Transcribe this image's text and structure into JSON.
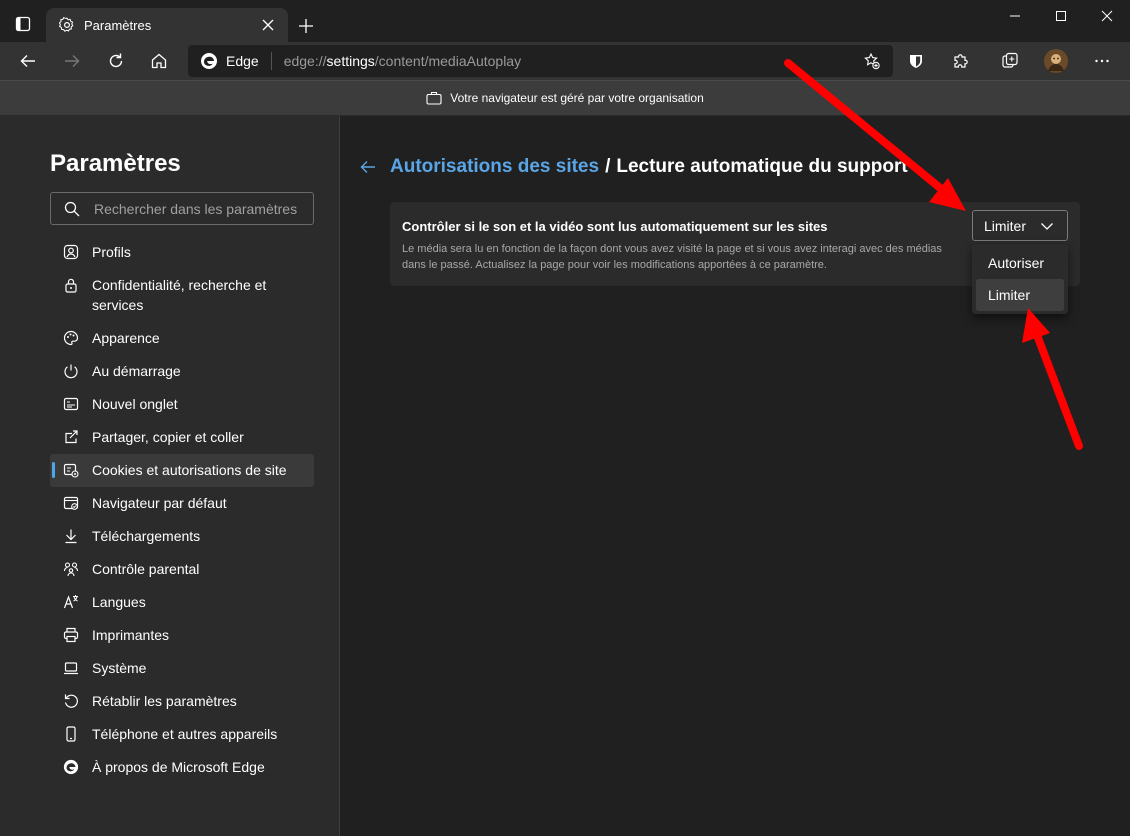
{
  "tab": {
    "title": "Paramètres"
  },
  "address": {
    "site_name": "Edge",
    "url_prefix": "edge://",
    "url_host": "settings",
    "url_path": "/content/mediaAutoplay"
  },
  "banner": {
    "text": "Votre navigateur est géré par votre organisation"
  },
  "sidebar": {
    "title": "Paramètres",
    "search_placeholder": "Rechercher dans les paramètres",
    "items": [
      {
        "label": "Profils",
        "icon": "profile-icon"
      },
      {
        "label": "Confidentialité, recherche et services",
        "icon": "lock-icon"
      },
      {
        "label": "Apparence",
        "icon": "palette-icon"
      },
      {
        "label": "Au démarrage",
        "icon": "power-icon"
      },
      {
        "label": "Nouvel onglet",
        "icon": "new-tab-icon"
      },
      {
        "label": "Partager, copier et coller",
        "icon": "share-icon"
      },
      {
        "label": "Cookies et autorisations de site",
        "icon": "cookies-icon"
      },
      {
        "label": "Navigateur par défaut",
        "icon": "default-browser-icon"
      },
      {
        "label": "Téléchargements",
        "icon": "download-icon"
      },
      {
        "label": "Contrôle parental",
        "icon": "family-icon"
      },
      {
        "label": "Langues",
        "icon": "languages-icon"
      },
      {
        "label": "Imprimantes",
        "icon": "printer-icon"
      },
      {
        "label": "Système",
        "icon": "laptop-icon"
      },
      {
        "label": "Rétablir les paramètres",
        "icon": "reset-icon"
      },
      {
        "label": "Téléphone et autres appareils",
        "icon": "phone-icon"
      },
      {
        "label": "À propos de Microsoft Edge",
        "icon": "edge-logo-icon"
      }
    ],
    "active_index": 6
  },
  "main": {
    "breadcrumb_link": "Autorisations des sites",
    "breadcrumb_sep": "/",
    "breadcrumb_current": "Lecture automatique du support",
    "setting_title": "Contrôler si le son et la vidéo sont lus automatiquement sur les sites",
    "setting_desc": "Le média sera lu en fonction de la façon dont vous avez visité la page et si vous avez interagi avec des médias dans le passé. Actualisez la page pour voir les modifications apportées à ce paramètre.",
    "select_value": "Limiter",
    "options": [
      "Autoriser",
      "Limiter"
    ]
  },
  "colors": {
    "accent": "#4ca6e8",
    "link": "#5aa5e6",
    "annotation_arrow": "#ff0000"
  }
}
